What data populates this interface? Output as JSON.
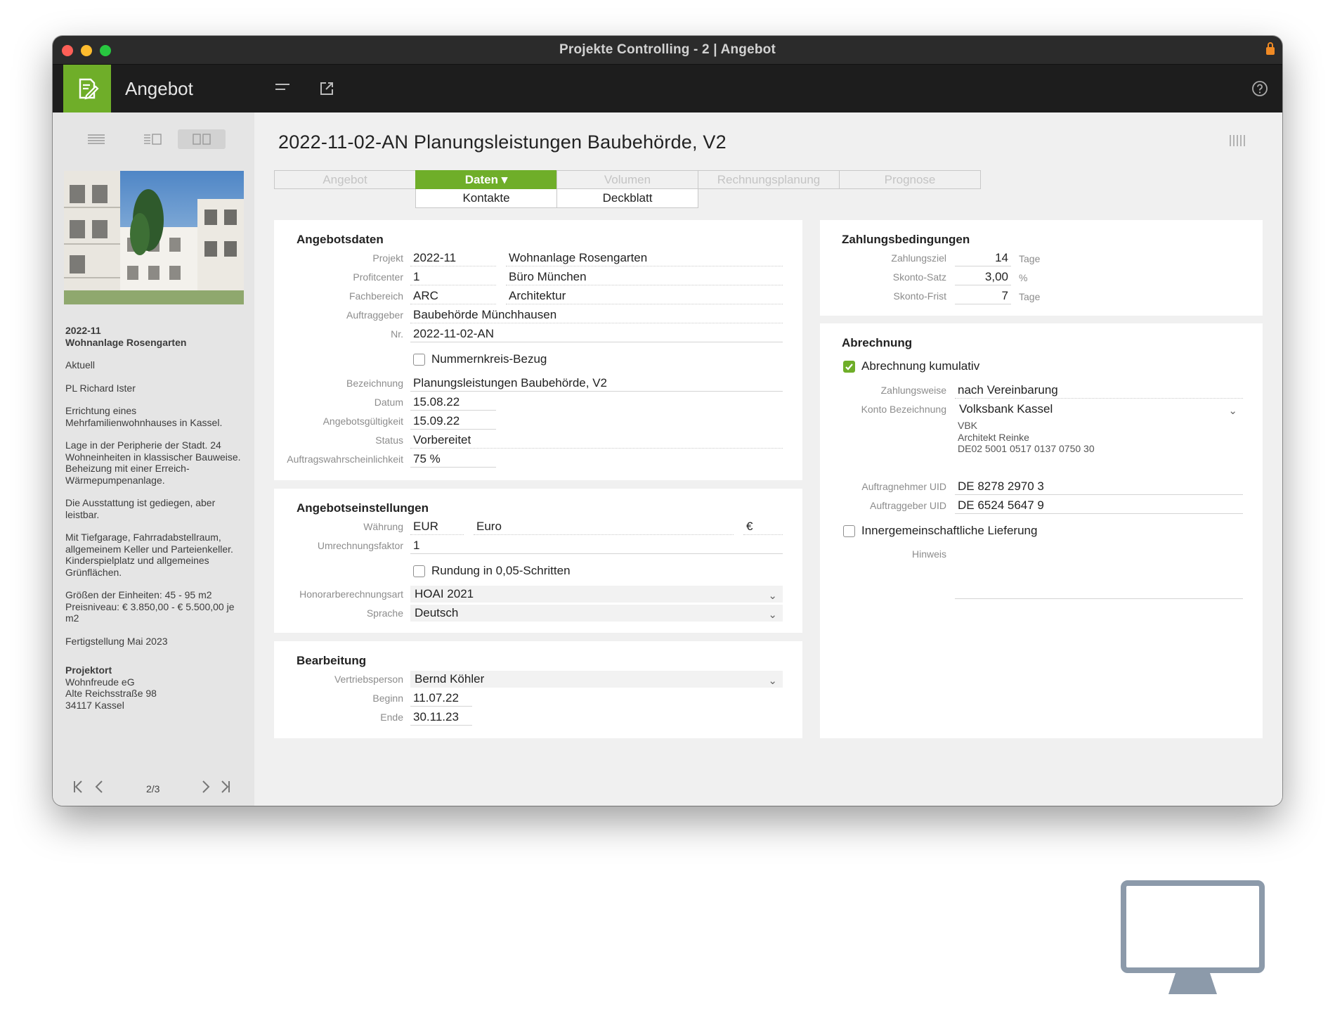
{
  "window": {
    "title": "Projekte Controlling - 2 | Angebot"
  },
  "header": {
    "title": "Angebot",
    "icons": [
      "document-edit-icon",
      "menu-lines-icon",
      "external-window-icon",
      "help-icon"
    ]
  },
  "sidebar": {
    "project_no": "2022-11",
    "project_name": "Wohnanlage Rosengarten",
    "status": "Aktuell",
    "pl": "PL Richard Ister",
    "paragraphs": [
      "Errichtung eines Mehrfamilienwohnhauses in Kassel.",
      "Lage in der Peripherie der Stadt. 24 Wohneinheiten in klassischer Bauweise. Beheizung mit einer Erreich-Wärmepumpenanlage.",
      "Die Ausstattung ist gediegen, aber leistbar.",
      "Mit Tiefgarage, Fahrradabstellraum, allgemeinem Keller und Parteienkeller. Kinderspielplatz und allgemeines Grünflächen.",
      "Größen der Einheiten: 45 - 95 m2 Preisniveau: € 3.850,00 - € 5.500,00 je m2",
      "Fertigstellung Mai 2023"
    ],
    "location_title": "Projektort",
    "location_lines": [
      "Wohnfreude eG",
      "Alte Reichsstraße 98",
      "34117 Kassel"
    ],
    "pager": "2/3"
  },
  "main": {
    "title": "2022-11-02-AN Planungsleistungen Baubehörde, V2",
    "tabs": [
      "Angebot",
      "Daten ▾",
      "Volumen",
      "Rechnungsplanung",
      "Prognose"
    ],
    "subtabs": [
      "Kontakte",
      "Deckblatt"
    ]
  },
  "angebotsdaten": {
    "title": "Angebotsdaten",
    "projekt_label": "Projekt",
    "projekt_code": "2022-11",
    "projekt_name": "Wohnanlage Rosengarten",
    "profitcenter_label": "Profitcenter",
    "profitcenter_code": "1",
    "profitcenter_name": "Büro München",
    "fachbereich_label": "Fachbereich",
    "fachbereich_code": "ARC",
    "fachbereich_name": "Architektur",
    "auftraggeber_label": "Auftraggeber",
    "auftraggeber": "Baubehörde Münchhausen",
    "nr_label": "Nr.",
    "nr": "2022-11-02-AN",
    "nummernkreis_label": "Nummernkreis-Bezug",
    "bezeichnung_label": "Bezeichnung",
    "bezeichnung": "Planungsleistungen Baubehörde, V2",
    "datum_label": "Datum",
    "datum": "15.08.22",
    "gueltigkeit_label": "Angebotsgültigkeit",
    "gueltigkeit": "15.09.22",
    "status_label": "Status",
    "status": "Vorbereitet",
    "wahrscheinlichkeit_label": "Auftragswahrscheinlichkeit",
    "wahrscheinlichkeit": "75 %"
  },
  "einstellungen": {
    "title": "Angebotseinstellungen",
    "waehrung_label": "Währung",
    "waehrung_code": "EUR",
    "waehrung_name": "Euro",
    "waehrung_symbol": "€",
    "faktor_label": "Umrechnungsfaktor",
    "faktor": "1",
    "rundung_label": "Rundung in 0,05-Schritten",
    "honorar_label": "Honorarberechnungsart",
    "honorar": "HOAI 2021",
    "sprache_label": "Sprache",
    "sprache": "Deutsch"
  },
  "bearbeitung": {
    "title": "Bearbeitung",
    "vertrieb_label": "Vertriebsperson",
    "vertrieb": "Bernd Köhler",
    "beginn_label": "Beginn",
    "beginn": "11.07.22",
    "ende_label": "Ende",
    "ende": "30.11.23"
  },
  "zahlung": {
    "title": "Zahlungsbedingungen",
    "ziel_label": "Zahlungsziel",
    "ziel": "14",
    "ziel_unit": "Tage",
    "skonto_label": "Skonto-Satz",
    "skonto": "3,00",
    "skonto_unit": "%",
    "frist_label": "Skonto-Frist",
    "frist": "7",
    "frist_unit": "Tage"
  },
  "abrechnung": {
    "title": "Abrechnung",
    "kumulativ_label": "Abrechnung kumulativ",
    "weise_label": "Zahlungsweise",
    "weise": "nach Vereinbarung",
    "konto_label": "Konto Bezeichnung",
    "konto": "Volksbank Kassel",
    "bank_lines": [
      "VBK",
      "Architekt Reinke",
      "DE02 5001 0517 0137 0750 30"
    ],
    "an_uid_label": "Auftragnehmer UID",
    "an_uid": "DE 8278 2970 3",
    "ag_uid_label": "Auftraggeber UID",
    "ag_uid": "DE 6524 5647 9",
    "innergem_label": "Innergemeinschaftliche Lieferung",
    "hinweis_label": "Hinweis"
  },
  "colors": {
    "accent": "#6fae29",
    "titlebar": "#2b2b2b",
    "header": "#1d1d1d",
    "sidebar": "#e5e5e5"
  }
}
